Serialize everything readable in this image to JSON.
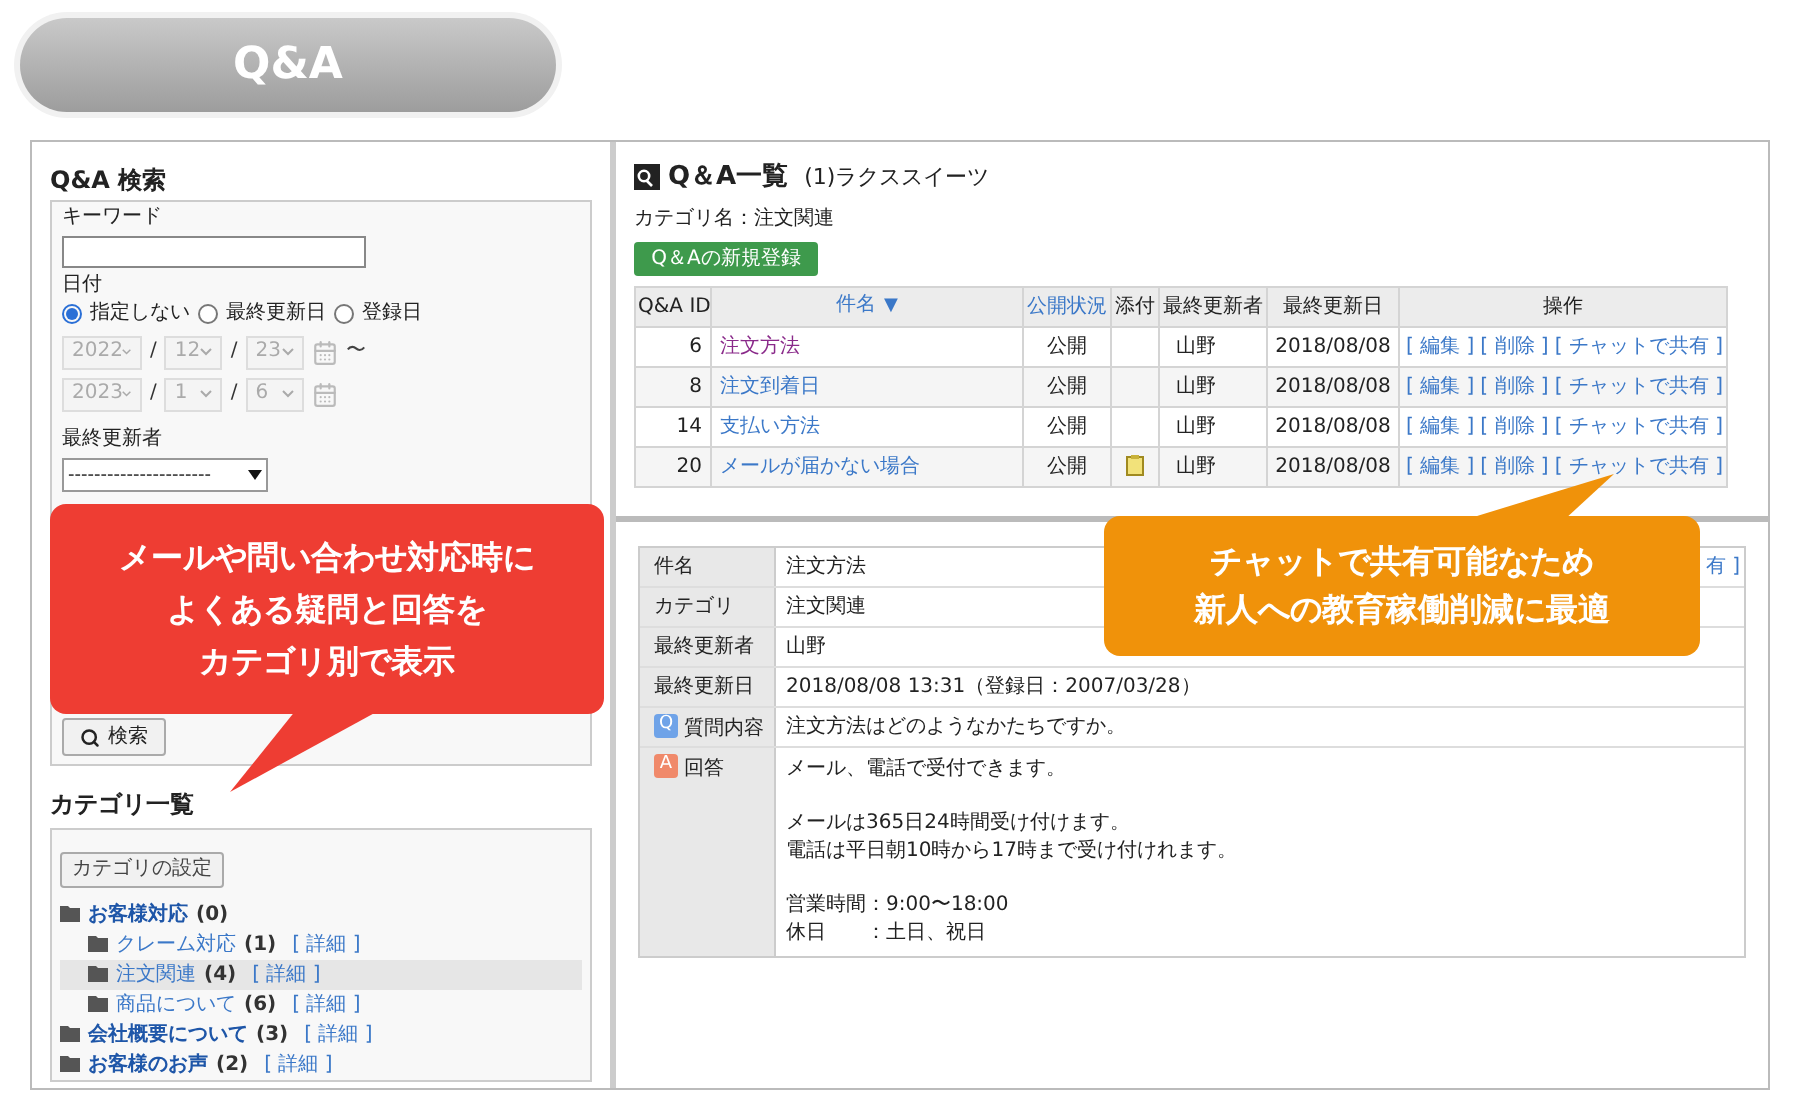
{
  "banner": {
    "title": "Q&A"
  },
  "search": {
    "title": "Q&A 検索",
    "keyword_label": "キーワード",
    "date_label": "日付",
    "date_options": [
      {
        "label": "指定しない",
        "selected": true
      },
      {
        "label": "最終更新日",
        "selected": false
      },
      {
        "label": "登録日",
        "selected": false
      }
    ],
    "dates_disabled": true,
    "date_separator": "/",
    "date_from": [
      "2022",
      "12",
      "23"
    ],
    "range_mark": "〜",
    "date_to": [
      "2023",
      "1",
      "6"
    ],
    "updater_label": "最終更新者",
    "updater_value": "----------------------",
    "search_button": "検索"
  },
  "categories": {
    "title": "カテゴリ一覧",
    "settings_button": "カテゴリの設定",
    "tree": [
      {
        "name": "お客様対応",
        "count": "(0)",
        "selected": false,
        "children": [
          {
            "name": "クレーム対応",
            "count": "(1)",
            "detail": "[ 詳細 ]",
            "selected": false
          },
          {
            "name": "注文関連",
            "count": "(4)",
            "detail": "[ 詳細 ]",
            "selected": true
          },
          {
            "name": "商品について",
            "count": "(6)",
            "detail": "[ 詳細 ]",
            "selected": false
          }
        ]
      },
      {
        "name": "会社概要について",
        "count": "(3)",
        "detail": "[ 詳細 ]",
        "selected": false
      },
      {
        "name": "お客様のお声",
        "count": "(2)",
        "detail": "[ 詳細 ]",
        "selected": false
      }
    ]
  },
  "list": {
    "title": "Q＆A一覧",
    "subtitle": "(1)ラクススイーツ",
    "category_line": "カテゴリ名：注文関連",
    "new_button": "Q＆Aの新規登録",
    "columns": [
      {
        "label": "Q&A ID",
        "link": false
      },
      {
        "label": "件名",
        "link": true,
        "sort_mark": "▼"
      },
      {
        "label": "公開状況",
        "link": true
      },
      {
        "label": "添付",
        "link": false
      },
      {
        "label": "最終更新者",
        "link": false
      },
      {
        "label": "最終更新日",
        "link": false
      },
      {
        "label": "操作",
        "link": false
      }
    ],
    "rows": [
      {
        "id": "6",
        "title": "注文方法",
        "visited": true,
        "status": "公開",
        "attachment": false,
        "updater": "山野",
        "date": "2018/08/08",
        "actions": [
          "[ 編集 ]",
          "[ 削除 ]",
          "[ チャットで共有 ]"
        ]
      },
      {
        "id": "8",
        "title": "注文到着日",
        "visited": false,
        "status": "公開",
        "attachment": false,
        "updater": "山野",
        "date": "2018/08/08",
        "actions": [
          "[ 編集 ]",
          "[ 削除 ]",
          "[ チャットで共有 ]"
        ]
      },
      {
        "id": "14",
        "title": "支払い方法",
        "visited": false,
        "status": "公開",
        "attachment": false,
        "updater": "山野",
        "date": "2018/08/08",
        "actions": [
          "[ 編集 ]",
          "[ 削除 ]",
          "[ チャットで共有 ]"
        ]
      },
      {
        "id": "20",
        "title": "メールが届かない場合",
        "visited": false,
        "status": "公開",
        "attachment": true,
        "updater": "山野",
        "date": "2018/08/08",
        "actions": [
          "[ 編集 ]",
          "[ 削除 ]",
          "[ チャットで共有 ]"
        ]
      }
    ]
  },
  "detail": {
    "rows": [
      {
        "label": "件名",
        "value": "注文方法",
        "trailing_link": "有 ]"
      },
      {
        "label": "カテゴリ",
        "value": "注文関連"
      },
      {
        "label": "最終更新者",
        "value": "山野"
      },
      {
        "label": "最終更新日",
        "value": "2018/08/08 13:31（登録日：2007/03/28）"
      }
    ],
    "question": {
      "badge": "Q",
      "label": "質問内容",
      "value": "注文方法はどのようなかたちですか。"
    },
    "answer": {
      "badge": "A",
      "label": "回答",
      "paragraphs": [
        [
          "メール、電話で受付できます。"
        ],
        [
          "メールは365日24時間受け付けます。",
          "電話は平日朝10時から17時まで受け付けれます。"
        ],
        [
          "営業時間：9:00〜18:00",
          "休日　　：土日、祝日"
        ]
      ]
    }
  },
  "callouts": [
    {
      "color": "#ee3d33",
      "lines": [
        "メールや問い合わせ対応時に",
        "よくある疑問と回答を",
        "カテゴリ別で表示"
      ]
    },
    {
      "color": "#f0920a",
      "lines": [
        "チャットで共有可能なため",
        "新人への教育稼働削減に最適"
      ]
    }
  ]
}
